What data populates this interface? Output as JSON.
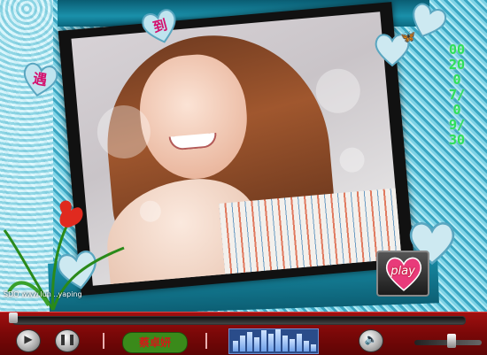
{
  "hearts": {
    "top_char": "到",
    "left_char": "遇"
  },
  "credit_text": "SDO www.lun ..yaping",
  "date_vertical": "00 2007/09/30",
  "play_button": {
    "label": "play"
  },
  "player": {
    "title": "蔡卓妍",
    "play_icon": "play-icon",
    "pause_icon": "pause-icon",
    "mute_icon": "speaker-icon"
  },
  "colors": {
    "bar_red": "#8a0a0a",
    "teal": "#1a90aa",
    "date_green": "#2ee05a",
    "heart_pink": "#d4116e"
  }
}
